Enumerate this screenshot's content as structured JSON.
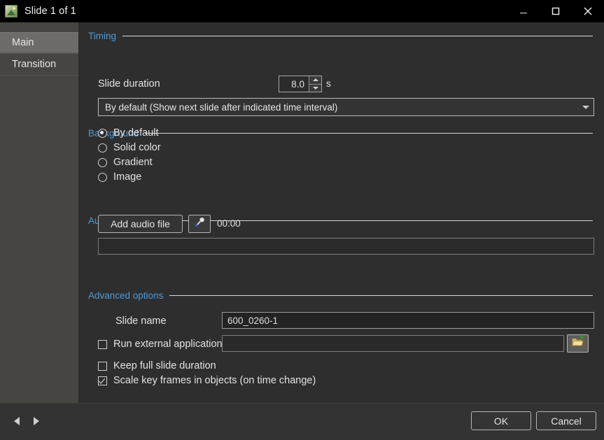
{
  "window": {
    "title": "Slide 1 of 1",
    "app_icon": "image-slide-icon",
    "controls": {
      "minimize": "minimize-icon",
      "maximize": "maximize-icon",
      "close": "close-icon"
    }
  },
  "sidebar": {
    "items": [
      {
        "label": "Main",
        "selected": true
      },
      {
        "label": "Transition",
        "selected": false
      }
    ]
  },
  "sections": {
    "timing": {
      "title": "Timing",
      "slide_duration_label": "Slide duration",
      "slide_duration_value": "8.0",
      "slide_duration_unit": "s",
      "mode_selected": "By default (Show next slide after indicated time interval)",
      "mode_options": [
        "By default (Show next slide after indicated time interval)"
      ]
    },
    "background": {
      "title": "Background",
      "options": [
        {
          "label": "By default",
          "selected": true
        },
        {
          "label": "Solid color",
          "selected": false
        },
        {
          "label": "Gradient",
          "selected": false
        },
        {
          "label": "Image",
          "selected": false
        }
      ]
    },
    "audio_comment": {
      "title": "Audio comment",
      "add_audio_label": "Add audio file",
      "record_icon": "microphone-icon",
      "duration": "00:00",
      "waveform_value": ""
    },
    "advanced_options": {
      "title": "Advanced options",
      "slide_name_label": "Slide name",
      "slide_name_value": "600_0260-1",
      "run_external_label": "Run external application",
      "run_external_checked": false,
      "run_external_path_value": "",
      "browse_icon": "folder-open-icon",
      "keep_full_duration_label": "Keep full slide duration",
      "keep_full_duration_checked": false,
      "scale_keyframes_label": "Scale key frames in objects (on time change)",
      "scale_keyframes_checked": true
    }
  },
  "footer": {
    "prev_icon": "triangle-left-icon",
    "next_icon": "triangle-right-icon",
    "ok_label": "OK",
    "cancel_label": "Cancel"
  },
  "colors": {
    "window_bg": "#2e2e2e",
    "titlebar_bg": "#000000",
    "sidebar_bg": "#474541",
    "sidebar_selected": "#6e6c68",
    "section_header": "#4f9ad6",
    "text": "#e3e3e3",
    "footer_bg": "#333333",
    "input_bg": "#232323",
    "border": "#b5b5b5"
  }
}
